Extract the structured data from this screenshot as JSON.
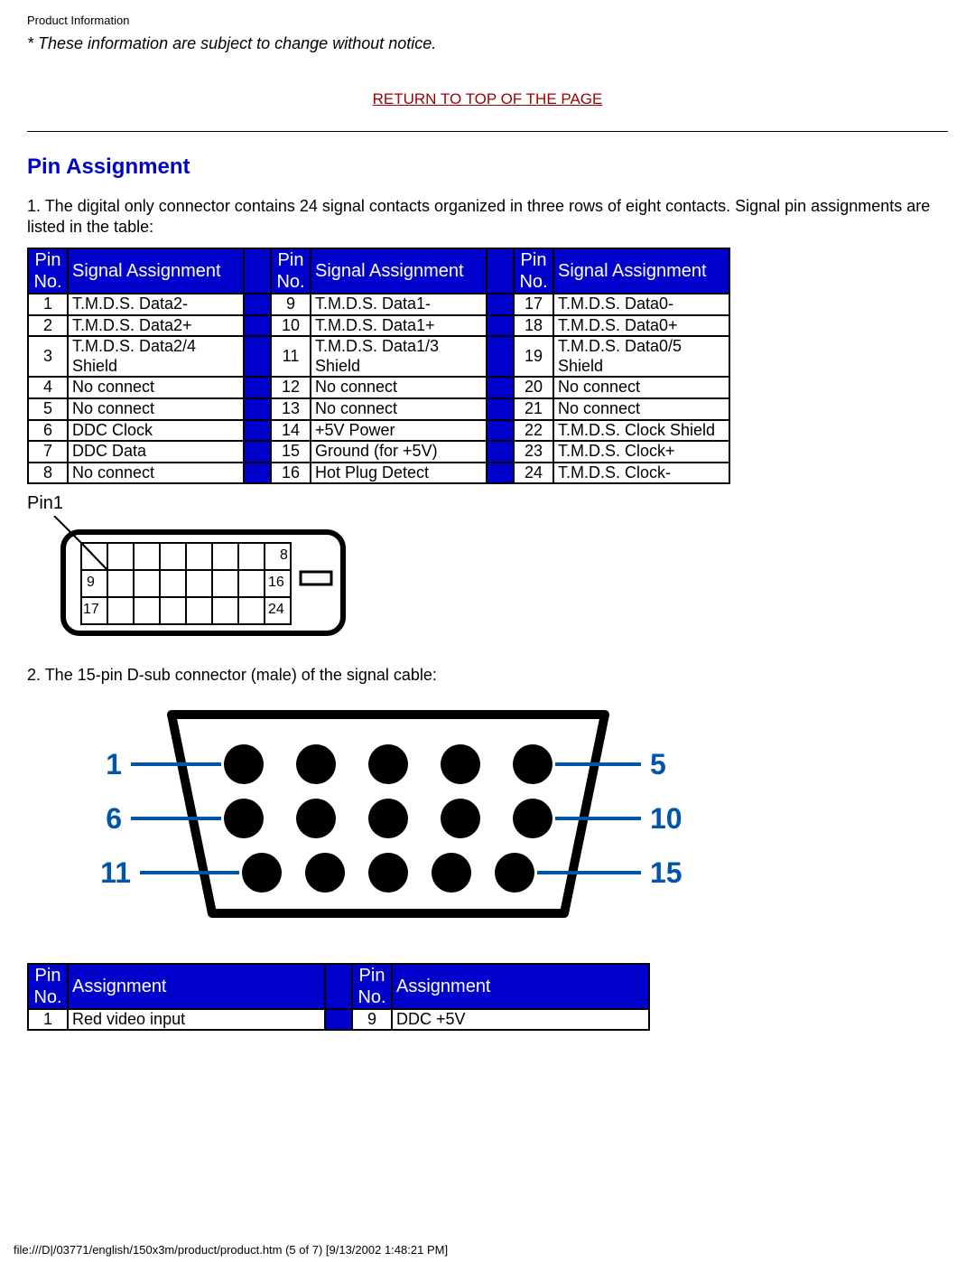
{
  "header_small": "Product Information",
  "notice": "* These information are subject to change without notice.",
  "return_link": "RETURN TO TOP OF THE PAGE",
  "section_title": "Pin Assignment",
  "description1": "1. The digital only connector contains 24 signal contacts organized in three rows of eight contacts. Signal pin assignments are listed in the table:",
  "table1": {
    "header_pin": "Pin No.",
    "header_signal": "Signal Assignment",
    "col1": [
      {
        "n": "1",
        "s": "T.M.D.S. Data2-"
      },
      {
        "n": "2",
        "s": "T.M.D.S. Data2+"
      },
      {
        "n": "3",
        "s": "T.M.D.S. Data2/4 Shield"
      },
      {
        "n": "4",
        "s": "No connect"
      },
      {
        "n": "5",
        "s": "No connect"
      },
      {
        "n": "6",
        "s": "DDC Clock"
      },
      {
        "n": "7",
        "s": "DDC Data"
      },
      {
        "n": "8",
        "s": "No connect"
      }
    ],
    "col2": [
      {
        "n": "9",
        "s": "T.M.D.S. Data1-"
      },
      {
        "n": "10",
        "s": "T.M.D.S. Data1+"
      },
      {
        "n": "11",
        "s": "T.M.D.S. Data1/3 Shield"
      },
      {
        "n": "12",
        "s": "No connect"
      },
      {
        "n": "13",
        "s": "No connect"
      },
      {
        "n": "14",
        "s": "+5V Power"
      },
      {
        "n": "15",
        "s": "Ground (for +5V)"
      },
      {
        "n": "16",
        "s": "Hot Plug Detect"
      }
    ],
    "col3": [
      {
        "n": "17",
        "s": "T.M.D.S. Data0-"
      },
      {
        "n": "18",
        "s": "T.M.D.S. Data0+"
      },
      {
        "n": "19",
        "s": "T.M.D.S. Data0/5 Shield"
      },
      {
        "n": "20",
        "s": "No connect"
      },
      {
        "n": "21",
        "s": "No connect"
      },
      {
        "n": "22",
        "s": "T.M.D.S. Clock Shield"
      },
      {
        "n": "23",
        "s": "T.M.D.S. Clock+"
      },
      {
        "n": "24",
        "s": "T.M.D.S. Clock-"
      }
    ]
  },
  "pin1_label": "Pin1",
  "dvi_pins": {
    "r1_end": "8",
    "r2_start": "9",
    "r2_end": "16",
    "r3_start": "17",
    "r3_end": "24"
  },
  "description2": "2. The 15-pin D-sub connector (male) of the signal cable:",
  "dsub_labels": {
    "l1": "1",
    "l2": "6",
    "l3": "11",
    "r1": "5",
    "r2": "10",
    "r3": "15"
  },
  "table2": {
    "header_pin": "Pin No.",
    "header_assign": "Assignment",
    "col1": [
      {
        "n": "1",
        "s": "Red video input"
      }
    ],
    "col2": [
      {
        "n": "9",
        "s": "DDC +5V"
      }
    ]
  },
  "footer": "file:///D|/03771/english/150x3m/product/product.htm (5 of 7) [9/13/2002 1:48:21 PM]"
}
